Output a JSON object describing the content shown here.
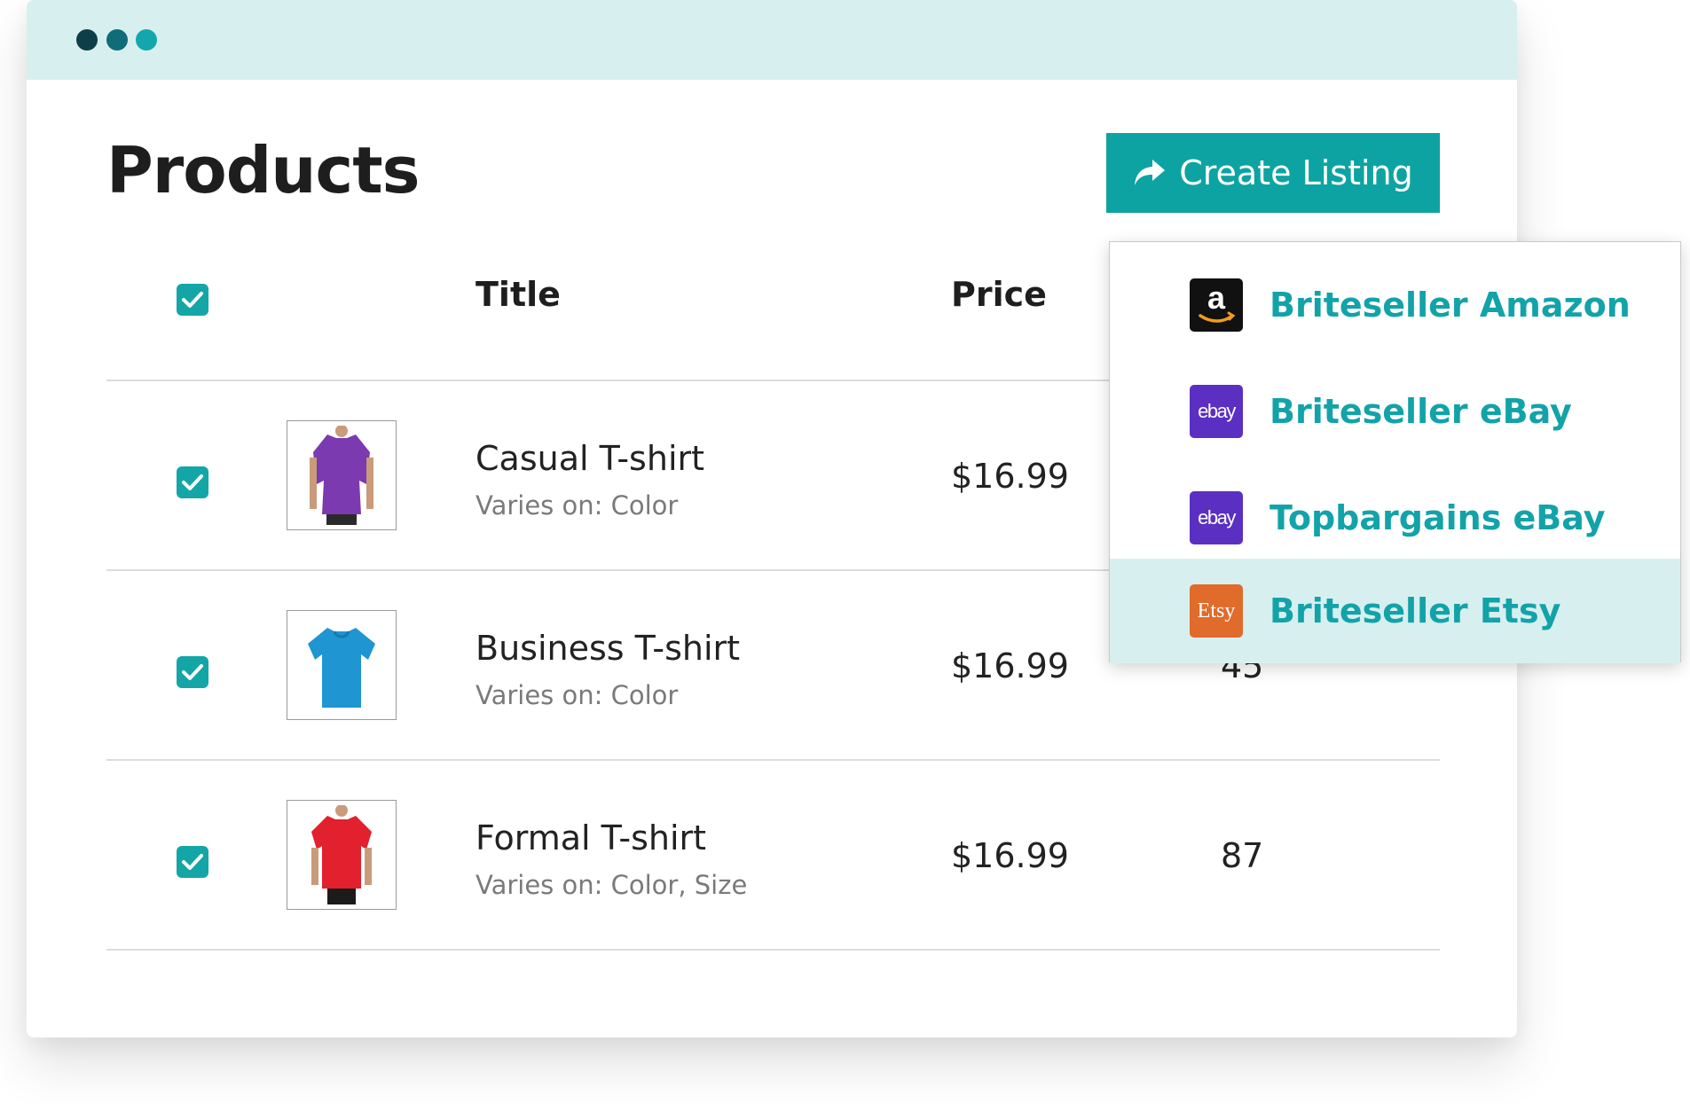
{
  "window": {
    "controls": [
      "close-dot",
      "minimize-dot",
      "maximize-dot"
    ]
  },
  "header": {
    "title": "Products",
    "create_button_label": "Create Listing",
    "create_button_icon": "share-arrow-icon"
  },
  "table": {
    "columns": [
      "Title",
      "Price"
    ],
    "rows": [
      {
        "title": "Casual T-shirt",
        "subtitle": "Varies on: Color",
        "price": "$16.99",
        "qty": "",
        "shirt_color": "#7b3ab0"
      },
      {
        "title": "Business T-shirt",
        "subtitle": "Varies on: Color",
        "price": "$16.99",
        "qty": "45",
        "shirt_color": "#1f95d1"
      },
      {
        "title": "Formal T-shirt",
        "subtitle": "Varies on: Color, Size",
        "price": "$16.99",
        "qty": "87",
        "shirt_color": "#e2202e"
      }
    ]
  },
  "dropdown": {
    "items": [
      {
        "label": "Briteseller Amazon",
        "icon": "amazon-icon",
        "icon_text": "a"
      },
      {
        "label": "Briteseller eBay",
        "icon": "ebay-icon",
        "icon_text": "ebay"
      },
      {
        "label": "Topbargains eBay",
        "icon": "ebay-icon",
        "icon_text": "ebay"
      },
      {
        "label": "Briteseller Etsy",
        "icon": "etsy-icon",
        "icon_text": "Etsy",
        "highlighted": true
      }
    ]
  },
  "colors": {
    "accent": "#0ea3a3",
    "titlebar": "#d8efef",
    "link": "#12a3a9"
  }
}
